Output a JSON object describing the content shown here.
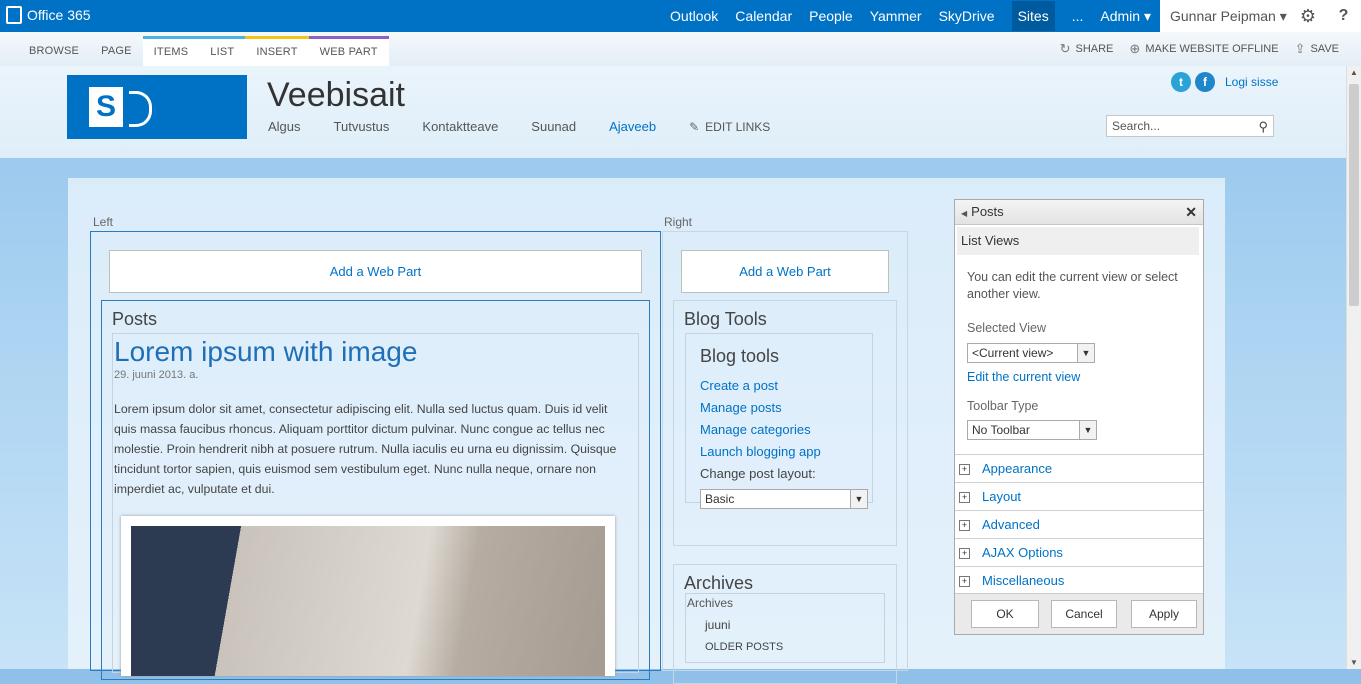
{
  "suitebar": {
    "brand": "Office 365",
    "nav": [
      "Outlook",
      "Calendar",
      "People",
      "Yammer",
      "SkyDrive",
      "Sites",
      "...",
      "Admin ▾"
    ],
    "user": "Gunnar Peipman ▾",
    "help": "?"
  },
  "ribbon": {
    "tabs": [
      "BROWSE",
      "PAGE",
      "ITEMS",
      "LIST",
      "INSERT",
      "WEB PART"
    ],
    "actions": [
      "SHARE",
      "MAKE WEBSITE OFFLINE",
      "SAVE"
    ]
  },
  "header": {
    "site_title": "Veebisait",
    "nav": [
      "Algus",
      "Tutvustus",
      "Kontaktteave",
      "Suunad",
      "Ajaveeb"
    ],
    "edit_links": "EDIT LINKS",
    "login": "Logi sisse",
    "search_placeholder": "Search..."
  },
  "zones": {
    "left_label": "Left",
    "right_label": "Right",
    "add_web_part": "Add a Web Part"
  },
  "posts": {
    "title": "Posts",
    "post_title": "Lorem ipsum with image",
    "date": "29. juuni 2013. a.",
    "body": "Lorem ipsum dolor sit amet, consectetur adipiscing elit. Nulla sed luctus quam. Duis id velit quis massa faucibus rhoncus. Aliquam porttitor dictum pulvinar. Nunc congue ac tellus nec molestie. Proin hendrerit nibh at posuere rutrum. Nulla iaculis eu urna eu dignissim. Quisque tincidunt tortor sapien, quis euismod sem vestibulum eget. Nunc nulla neque, ornare non imperdiet ac, vulputate et dui."
  },
  "blog_tools": {
    "title": "Blog Tools",
    "inner_title": "Blog tools",
    "links": [
      "Create a post",
      "Manage posts",
      "Manage categories",
      "Launch blogging app"
    ],
    "layout_label": "Change post layout:",
    "layout_value": "Basic"
  },
  "archives": {
    "title": "Archives",
    "inner_title": "Archives",
    "month": "juuni",
    "older": "OLDER POSTS"
  },
  "toolpane": {
    "title": "Posts",
    "section": "List Views",
    "description": "You can edit the current view or select another view.",
    "selected_view_label": "Selected View",
    "selected_view_value": "<Current view>",
    "edit_view_link": "Edit the current view",
    "toolbar_label": "Toolbar Type",
    "toolbar_value": "No Toolbar",
    "collapsible": [
      "Appearance",
      "Layout",
      "Advanced",
      "AJAX Options",
      "Miscellaneous"
    ],
    "buttons": [
      "OK",
      "Cancel",
      "Apply"
    ]
  }
}
